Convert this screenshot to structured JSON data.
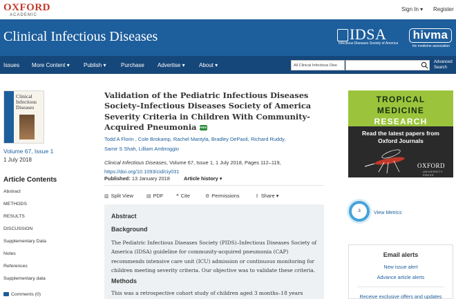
{
  "site": {
    "logo_line1": "OXFORD",
    "logo_line2": "ACADEMIC",
    "sign_in": "Sign In ▾",
    "register": "Register"
  },
  "journal": {
    "title": "Clinical Infectious Diseases",
    "idsa": "IDSA",
    "idsa_sub": "Infectious Diseases Society of America",
    "hivma": "hivma",
    "hivma_sub": "hiv medicine association"
  },
  "nav": {
    "items": [
      "Issues",
      "More Content ▾",
      "Publish ▾",
      "Purchase",
      "Advertise ▾",
      "About ▾"
    ],
    "search_scope": "All Clinical Infectious Dise",
    "search_value": "",
    "advanced_line1": "Advanced",
    "advanced_line2": "Search"
  },
  "issue": {
    "cover_title": "Clinical Infectious Diseases",
    "volume": "Volume 67, Issue 1",
    "date": "1 July 2018"
  },
  "contents": {
    "title": "Article Contents",
    "items": [
      "Abstract",
      "METHODS",
      "RESULTS",
      "DISCUSSION",
      "Supplementary Data",
      "Notes",
      "References",
      "Supplementary data"
    ],
    "comments": "Comments (0)"
  },
  "article": {
    "title": "Validation of the Pediatric Infectious Diseases Society–Infectious Diseases Society of America Severity Criteria in Children With Community-Acquired Pneumonia",
    "free_badge": "FREE",
    "authors_line1": "Todd A Florin , Cole Brokamp, Rachel Mantyla, Bradley DePaoli, Richard Ruddy,",
    "authors_line2": "Samir S Shah, Lilliam Ambroggio",
    "citation_journal": "Clinical Infectious Diseases",
    "citation_rest": ", Volume 67, Issue 1, 1 July 2018, Pages 112–119,",
    "doi": "https://doi.org/10.1093/cid/ciy031",
    "published_label": "Published:",
    "published_date": "13 January 2018",
    "history": "Article history ▾"
  },
  "tools": {
    "split_view": "Split View",
    "pdf": "PDF",
    "cite": "Cite",
    "permissions": "Permissions",
    "share": "Share ▾"
  },
  "abstract": {
    "heading": "Abstract",
    "background_heading": "Background",
    "background_text": "The Pediatric Infectious Diseases Society (PIDS)–Infectious Diseases Society of America (IDSA) guideline for community-acquired pneumonia (CAP) recommends intensive care unit (ICU) admission or continuous monitoring for children meeting severity criteria. Our objective was to validate these criteria.",
    "methods_heading": "Methods",
    "methods_text": "This was a retrospective cohort study of children aged 3 months–18 years"
  },
  "ad": {
    "headline1": "TROPICAL",
    "headline2": "MEDICINE",
    "headline3": "RESEARCH",
    "body": "Read the latest papers from Oxford Journals",
    "brand": "OXFORD",
    "brand_sub": "UNIVERSITY PRESS"
  },
  "metrics": {
    "count": "3",
    "link": "View Metrics"
  },
  "email_alerts": {
    "heading": "Email alerts",
    "new_issue": "New issue alert",
    "advance": "Advance article alerts",
    "receive": "Receive exclusive offers and updates"
  }
}
